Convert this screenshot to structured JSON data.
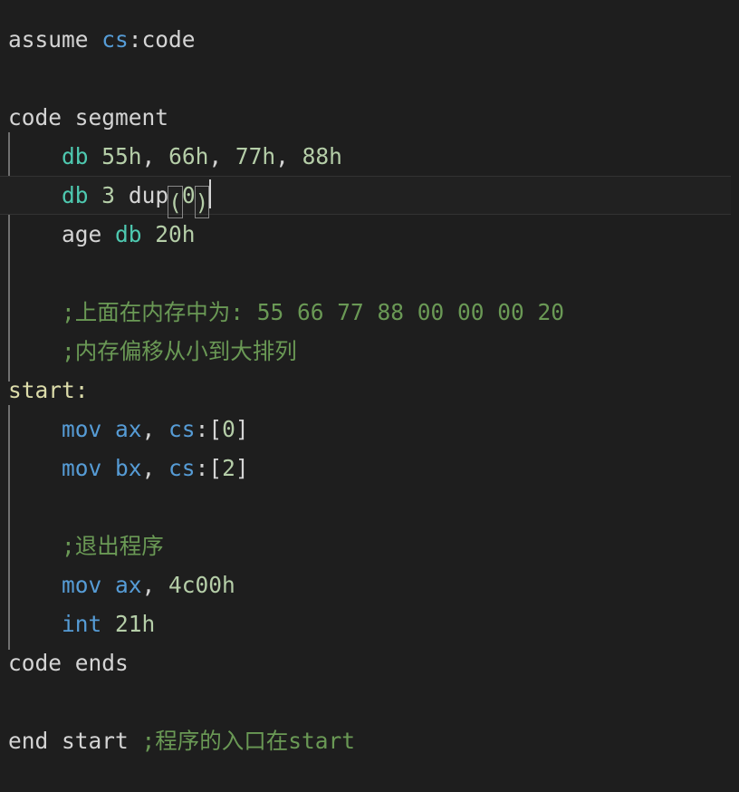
{
  "editor": {
    "language": "assembly-x86",
    "theme_background": "#1e1e1e",
    "current_line_background": "#212121",
    "indent_guide_color": "#707070",
    "colors": {
      "plain": "#d4d4d4",
      "keyword": "#569cd6",
      "type": "#4ec9b0",
      "number": "#b5cea8",
      "comment": "#6a9955",
      "label": "#dcdcaa",
      "bracket_match_border": "#888888",
      "caret": "#d4d4d4"
    },
    "current_line_index": 4,
    "caret": {
      "line": 4,
      "after_text": "db 3 dup(0)"
    }
  },
  "code": {
    "lines": [
      {
        "id": 1,
        "indent": "",
        "tokens": [
          {
            "text": "assume ",
            "kind": "plain"
          },
          {
            "text": "cs",
            "kind": "keyword"
          },
          {
            "text": ":code",
            "kind": "plain"
          }
        ]
      },
      {
        "id": 2,
        "indent": "",
        "tokens": []
      },
      {
        "id": 3,
        "indent": "",
        "tokens": [
          {
            "text": "code segment",
            "kind": "plain"
          }
        ]
      },
      {
        "id": 4,
        "indent": "    ",
        "tokens": [
          {
            "text": "db",
            "kind": "type"
          },
          {
            "text": " 55h",
            "kind": "number"
          },
          {
            "text": ",",
            "kind": "plain"
          },
          {
            "text": " 66h",
            "kind": "number"
          },
          {
            "text": ",",
            "kind": "plain"
          },
          {
            "text": " 77h",
            "kind": "number"
          },
          {
            "text": ",",
            "kind": "plain"
          },
          {
            "text": " 88h",
            "kind": "number"
          }
        ]
      },
      {
        "id": 5,
        "indent": "    ",
        "current": true,
        "tokens": [
          {
            "text": "db",
            "kind": "type"
          },
          {
            "text": " ",
            "kind": "plain"
          },
          {
            "text": "3",
            "kind": "number"
          },
          {
            "text": " dup",
            "kind": "plain"
          },
          {
            "text": "(",
            "kind": "bracket"
          },
          {
            "text": "0",
            "kind": "number"
          },
          {
            "text": ")",
            "kind": "bracket"
          },
          {
            "text": "",
            "kind": "caret"
          }
        ]
      },
      {
        "id": 6,
        "indent": "    ",
        "tokens": [
          {
            "text": "age ",
            "kind": "plain"
          },
          {
            "text": "db",
            "kind": "type"
          },
          {
            "text": " 20h",
            "kind": "number"
          }
        ]
      },
      {
        "id": 7,
        "indent": "",
        "tokens": []
      },
      {
        "id": 8,
        "indent": "    ",
        "tokens": [
          {
            "text": ";上面在内存中为: 55 66 77 88 00 00 00 20",
            "kind": "comment"
          }
        ]
      },
      {
        "id": 9,
        "indent": "    ",
        "tokens": [
          {
            "text": ";内存偏移从小到大排列",
            "kind": "comment"
          }
        ]
      },
      {
        "id": 10,
        "indent": "",
        "tokens": [
          {
            "text": "start:",
            "kind": "label"
          }
        ]
      },
      {
        "id": 11,
        "indent": "    ",
        "tokens": [
          {
            "text": "mov ax",
            "kind": "keyword"
          },
          {
            "text": ", ",
            "kind": "plain"
          },
          {
            "text": "cs",
            "kind": "keyword"
          },
          {
            "text": ":[",
            "kind": "plain"
          },
          {
            "text": "0",
            "kind": "number"
          },
          {
            "text": "]",
            "kind": "plain"
          }
        ]
      },
      {
        "id": 12,
        "indent": "    ",
        "tokens": [
          {
            "text": "mov bx",
            "kind": "keyword"
          },
          {
            "text": ", ",
            "kind": "plain"
          },
          {
            "text": "cs",
            "kind": "keyword"
          },
          {
            "text": ":[",
            "kind": "plain"
          },
          {
            "text": "2",
            "kind": "number"
          },
          {
            "text": "]",
            "kind": "plain"
          }
        ]
      },
      {
        "id": 13,
        "indent": "",
        "tokens": []
      },
      {
        "id": 14,
        "indent": "    ",
        "tokens": [
          {
            "text": ";退出程序",
            "kind": "comment"
          }
        ]
      },
      {
        "id": 15,
        "indent": "    ",
        "tokens": [
          {
            "text": "mov ax",
            "kind": "keyword"
          },
          {
            "text": ", ",
            "kind": "plain"
          },
          {
            "text": "4c00h",
            "kind": "number"
          }
        ]
      },
      {
        "id": 16,
        "indent": "    ",
        "tokens": [
          {
            "text": "int",
            "kind": "keyword"
          },
          {
            "text": " 21h",
            "kind": "number"
          }
        ]
      },
      {
        "id": 17,
        "indent": "",
        "tokens": [
          {
            "text": "code ends",
            "kind": "plain"
          }
        ]
      },
      {
        "id": 18,
        "indent": "",
        "tokens": []
      },
      {
        "id": 19,
        "indent": "",
        "tokens": [
          {
            "text": "end start ",
            "kind": "plain"
          },
          {
            "text": ";程序的入口在start",
            "kind": "comment"
          }
        ]
      }
    ]
  }
}
